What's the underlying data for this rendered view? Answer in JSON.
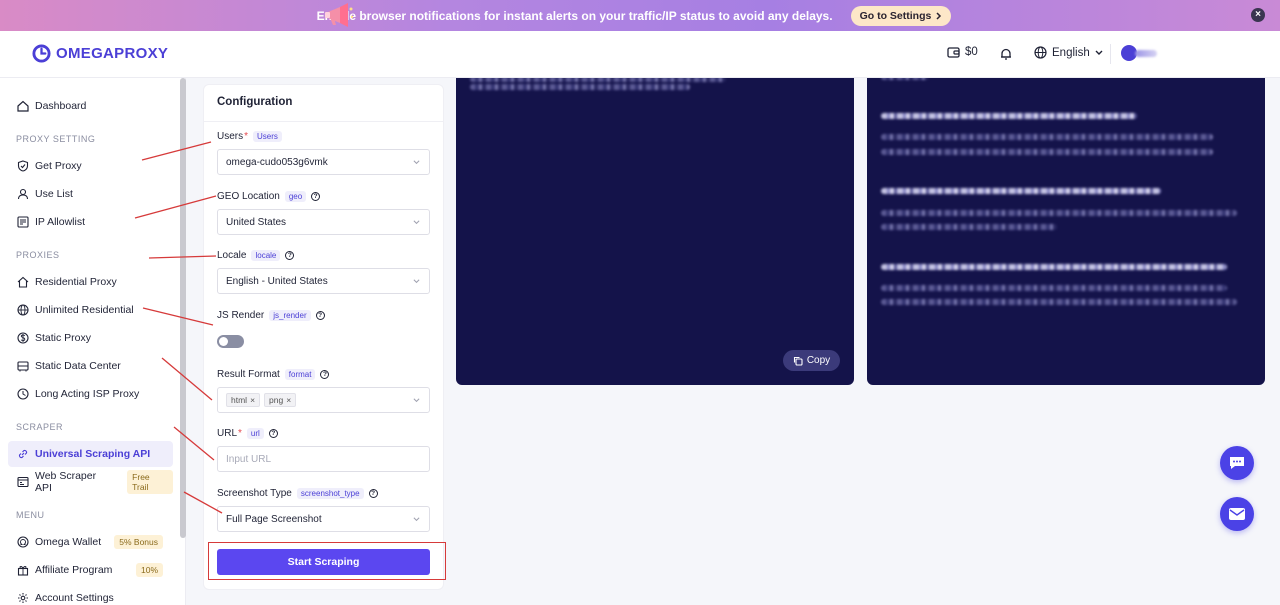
{
  "banner": {
    "message": "Enable browser notifications for instant alerts on your traffic/IP status to avoid any delays.",
    "action_label": "Go to Settings",
    "close_glyph": "×"
  },
  "header": {
    "brand": "OMEGAPROXY",
    "balance": "$0",
    "language": "English"
  },
  "sidebar": {
    "dashboard": "Dashboard",
    "sections": {
      "proxy_setting": "PROXY SETTING",
      "proxies": "PROXIES",
      "scraper": "SCRAPER",
      "menu": "MENU"
    },
    "items": {
      "get_proxy": "Get Proxy",
      "use_list": "Use List",
      "ip_allowlist": "IP Allowlist",
      "residential_proxy": "Residential Proxy",
      "unlimited_residential": "Unlimited Residential",
      "static_proxy": "Static Proxy",
      "static_data_center": "Static Data Center",
      "long_acting_isp_proxy": "Long Acting ISP Proxy",
      "universal_scraping_api": "Universal Scraping API",
      "web_scraper_api": "Web Scraper API",
      "omega_wallet": "Omega Wallet",
      "affiliate_program": "Affiliate Program",
      "account_settings": "Account Settings"
    },
    "badges": {
      "free_trail": "Free Trail",
      "bonus": "5% Bonus",
      "affiliate": "10%"
    }
  },
  "config": {
    "title": "Configuration",
    "users": {
      "label": "Users",
      "tag": "Users",
      "value": "omega-cudo053g6vmk"
    },
    "geo": {
      "label": "GEO Location",
      "tag": "geo",
      "value": "United States"
    },
    "locale": {
      "label": "Locale",
      "tag": "locale",
      "value": "English - United States"
    },
    "js_render": {
      "label": "JS Render",
      "tag": "js_render",
      "enabled": false
    },
    "result_format": {
      "label": "Result Format",
      "tag": "format",
      "chips": [
        "html",
        "png"
      ]
    },
    "url": {
      "label": "URL",
      "tag": "url",
      "placeholder": "Input URL"
    },
    "screenshot": {
      "label": "Screenshot Type",
      "tag": "screenshot_type",
      "value": "Full Page Screenshot"
    },
    "required_mark": "*",
    "help_glyph": "?",
    "chip_remove": "×",
    "submit_label": "Start Scraping"
  },
  "output": {
    "copy_label": "Copy"
  },
  "colors": {
    "accent": "#5b47f0",
    "brand": "#4b3fd6",
    "dark_panel": "#14134a",
    "annotation": "#d63a3a"
  }
}
